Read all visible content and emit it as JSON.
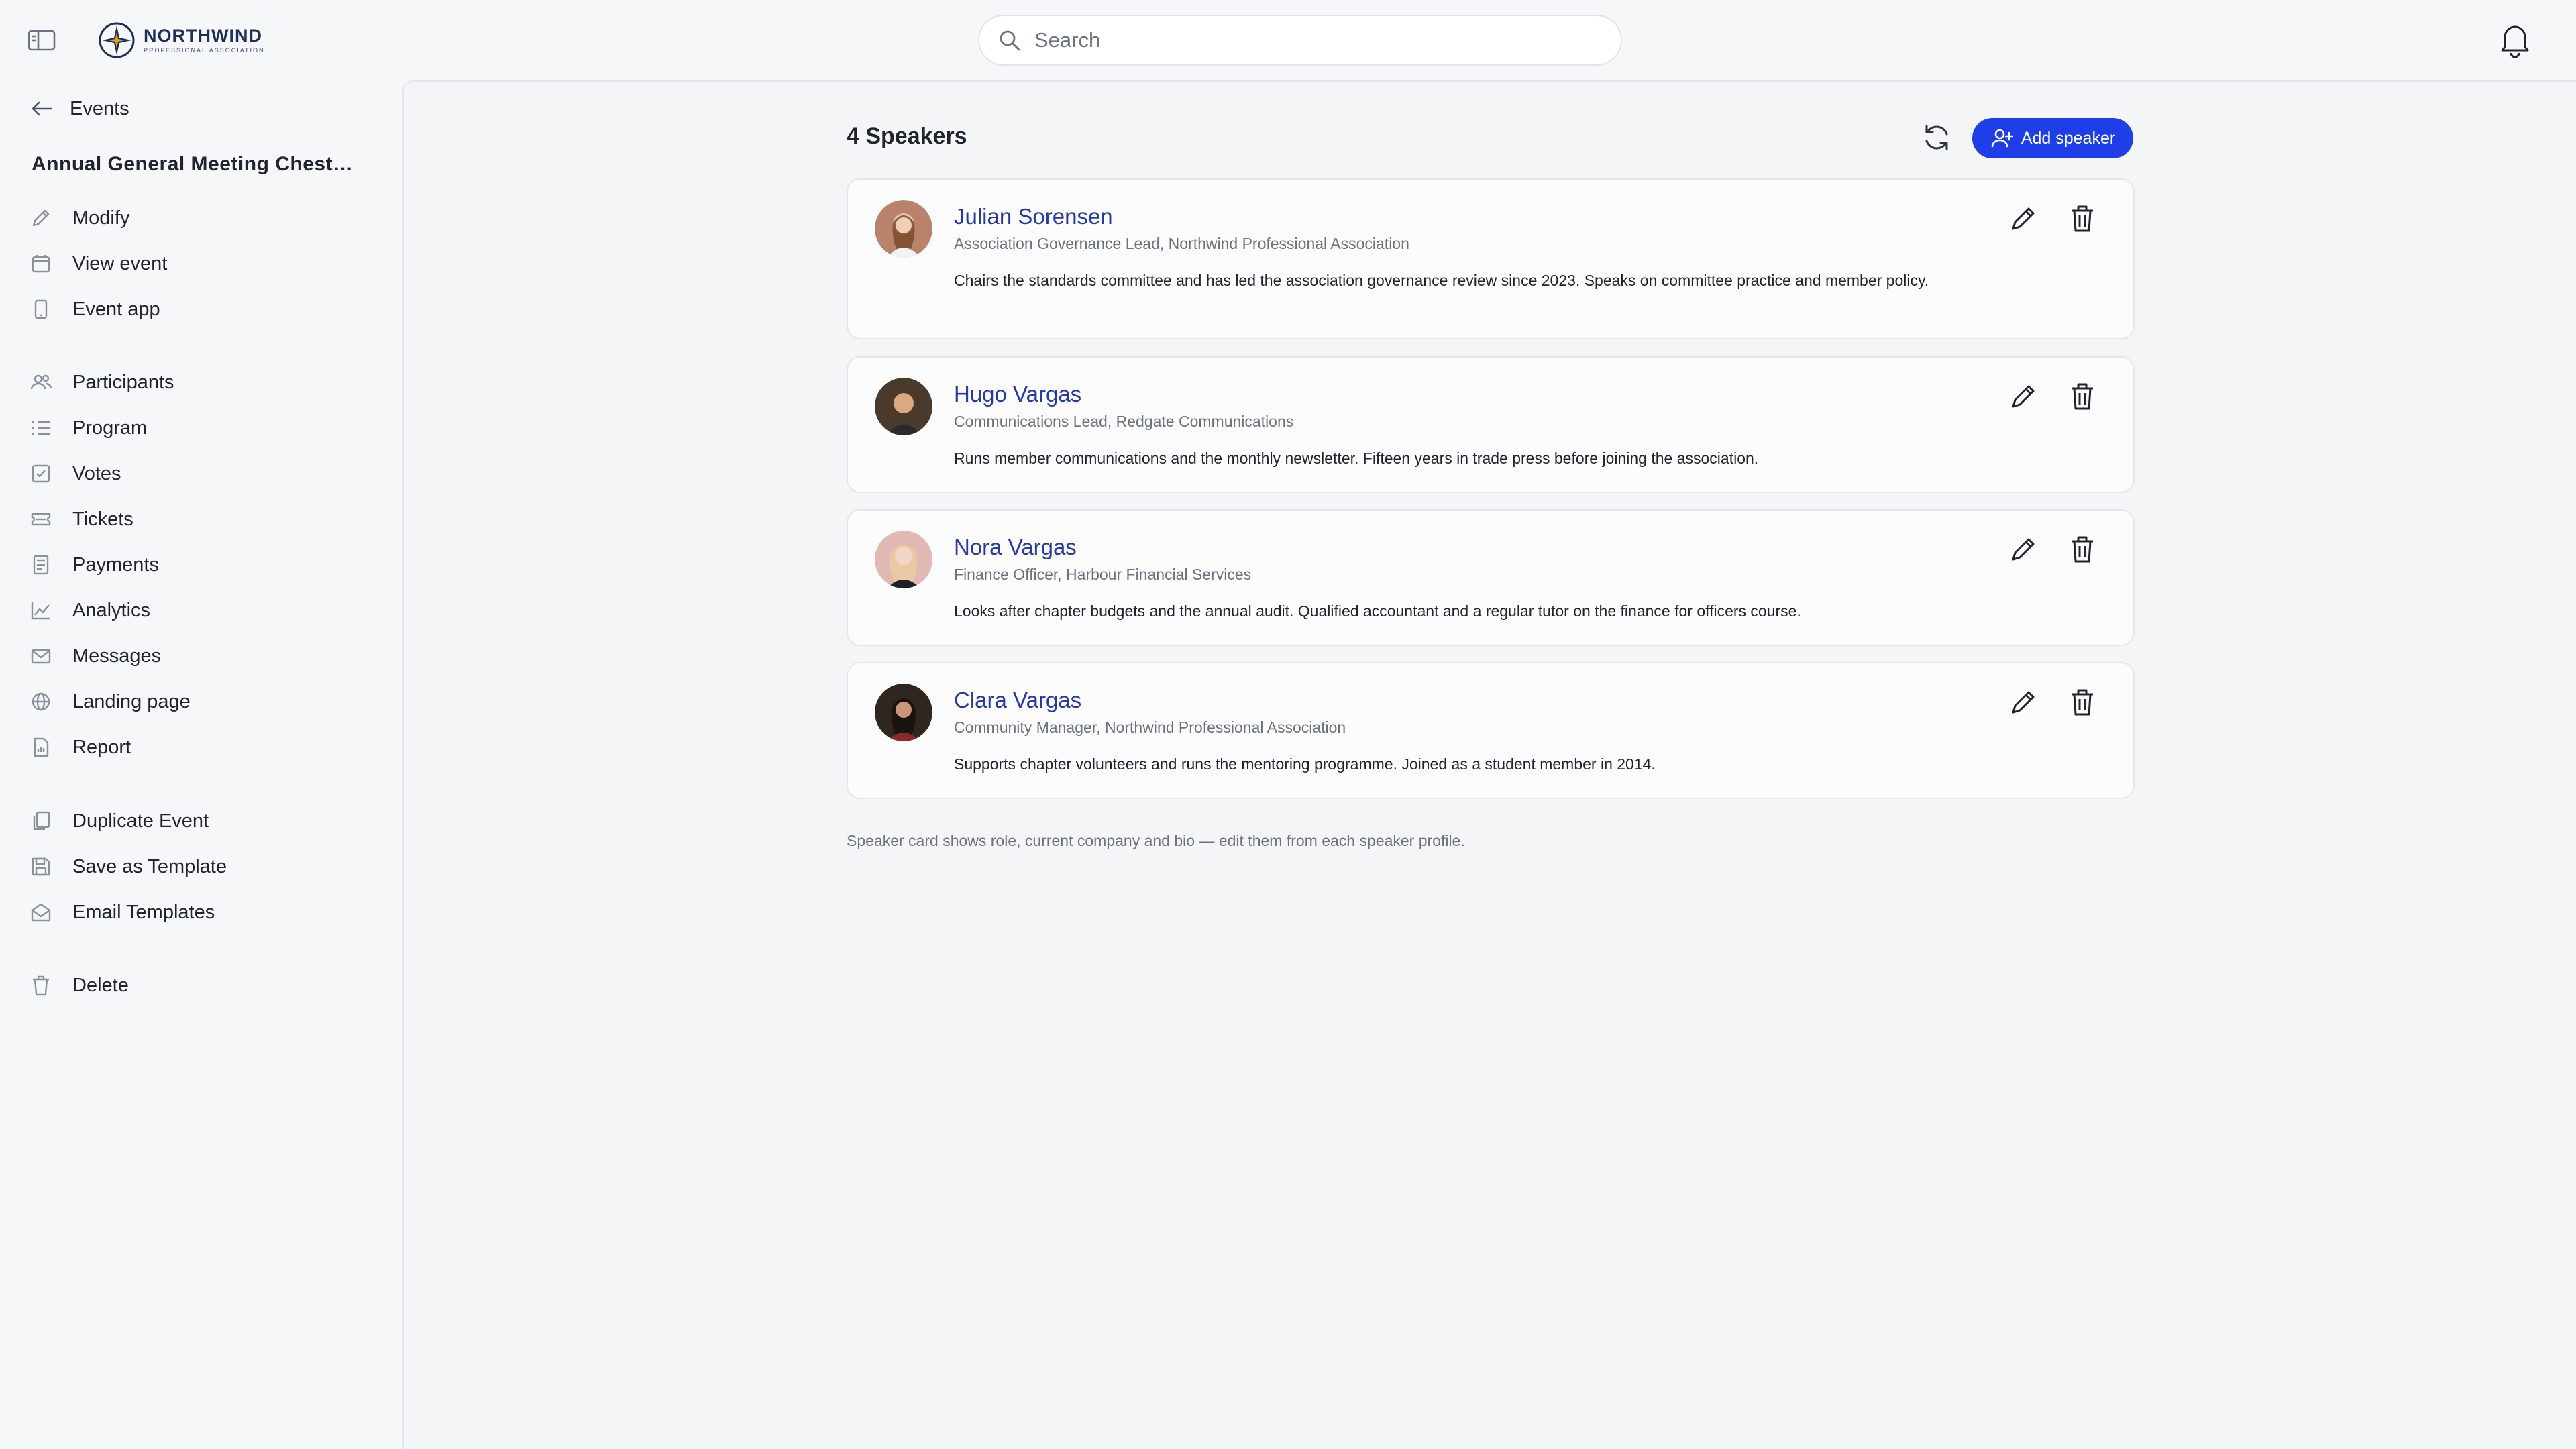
{
  "header": {
    "logo": {
      "name": "NORTHWIND",
      "subtitle": "PROFESSIONAL ASSOCIATION"
    },
    "search": {
      "placeholder": "Search",
      "value": ""
    }
  },
  "sidebar": {
    "back_label": "Events",
    "event_title": "Annual General Meeting Chester Chapter",
    "groups": [
      [
        {
          "label": "Modify",
          "icon": "pencil-icon"
        },
        {
          "label": "View event",
          "icon": "calendar-icon"
        },
        {
          "label": "Event app",
          "icon": "phone-icon"
        }
      ],
      [
        {
          "label": "Participants",
          "icon": "users-icon"
        },
        {
          "label": "Program",
          "icon": "list-icon"
        },
        {
          "label": "Votes",
          "icon": "ballot-icon"
        },
        {
          "label": "Tickets",
          "icon": "ticket-icon"
        },
        {
          "label": "Payments",
          "icon": "receipt-icon"
        },
        {
          "label": "Analytics",
          "icon": "chart-icon"
        },
        {
          "label": "Messages",
          "icon": "mail-icon"
        },
        {
          "label": "Landing page",
          "icon": "globe-icon"
        },
        {
          "label": "Report",
          "icon": "report-icon"
        }
      ],
      [
        {
          "label": "Duplicate Event",
          "icon": "copy-icon"
        },
        {
          "label": "Save as Template",
          "icon": "save-icon"
        },
        {
          "label": "Email Templates",
          "icon": "envelope-open-icon"
        }
      ],
      [
        {
          "label": "Delete",
          "icon": "trash-icon"
        }
      ]
    ]
  },
  "main": {
    "heading": "4 Speakers",
    "add_speaker_label": "Add speaker",
    "speakers": [
      {
        "name": "Julian Sorensen",
        "role": "Association Governance Lead, Northwind Professional Association",
        "bio": "Chairs the standards committee and has led the association governance review since 2023. Speaks on committee practice and member policy.",
        "avatar_color": "#b9826a"
      },
      {
        "name": "Hugo Vargas",
        "role": "Communications Lead, Redgate Communications",
        "bio": "Runs member communications and the monthly newsletter. Fifteen years in trade press before joining the association.",
        "avatar_color": "#4a3a2c"
      },
      {
        "name": "Nora Vargas",
        "role": "Finance Officer, Harbour Financial Services",
        "bio": "Looks after chapter budgets and the annual audit. Qualified accountant and a regular tutor on the finance for officers course.",
        "avatar_color": "#e2b8b4"
      },
      {
        "name": "Clara Vargas",
        "role": "Community Manager, Northwind Professional Association",
        "bio": "Supports chapter volunteers and runs the mentoring programme. Joined as a student member in 2014.",
        "avatar_color": "#2e2620"
      }
    ],
    "footnote": "Speaker card shows role, current company and bio — edit them from each speaker profile."
  },
  "colors": {
    "accent": "#1d3ee8",
    "speaker_name": "#2639a6",
    "muted_text": "#6b7280"
  }
}
